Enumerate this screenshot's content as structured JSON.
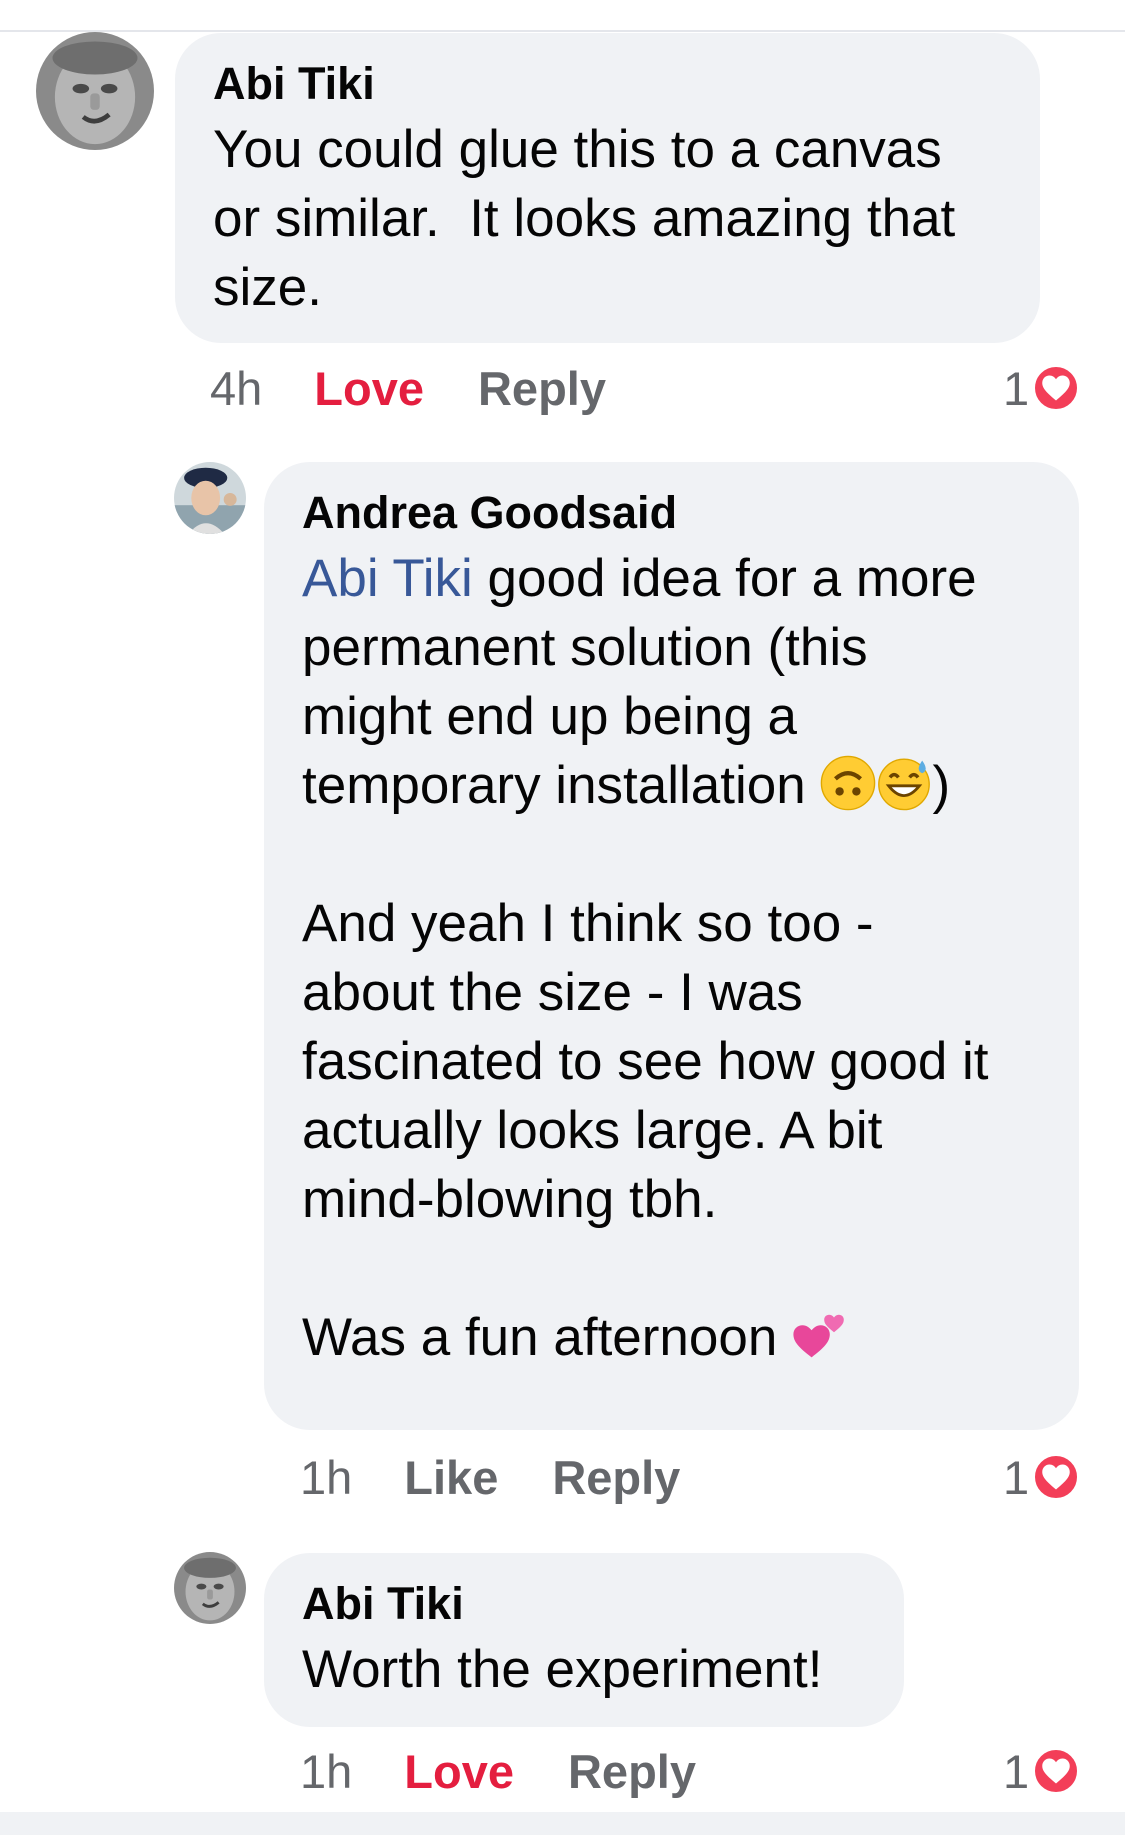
{
  "comments": [
    {
      "author": "Abi Tiki",
      "text": "You could glue this to a canvas\nor similar.  It looks amazing that\nsize.",
      "time": "4h",
      "action_like": "Love",
      "action_reply": "Reply",
      "reaction_count": "1",
      "avatar": "abi-tiki-avatar"
    },
    {
      "author": "Andrea Goodsaid",
      "mention": "Abi Tiki",
      "text_line1_rest": " good idea for a more",
      "text_line2": "permanent solution (this\nmight end up being a\ntemporary installation ",
      "text_close_paren": ")",
      "text_paragraph2": "And yeah I think so too -\nabout the size - I was\nfascinated to see how good it\nactually looks large. A bit\nmind-blowing tbh.",
      "text_paragraph3": "Was a fun afternoon ",
      "emojis": [
        "upside-down-face-emoji",
        "grinning-sweat-emoji",
        "two-hearts-emoji"
      ],
      "time": "1h",
      "action_like": "Like",
      "action_reply": "Reply",
      "reaction_count": "1",
      "avatar": "andrea-goodsaid-avatar"
    },
    {
      "author": "Abi Tiki",
      "text": "Worth the experiment!",
      "time": "1h",
      "action_like": "Love",
      "action_reply": "Reply",
      "reaction_count": "1",
      "avatar": "abi-tiki-avatar"
    }
  ],
  "colors": {
    "bubble": "#f0f2f5",
    "love": "#e41e3f",
    "mention": "#385898",
    "meta": "#65676b",
    "heart": "#f33e58"
  }
}
